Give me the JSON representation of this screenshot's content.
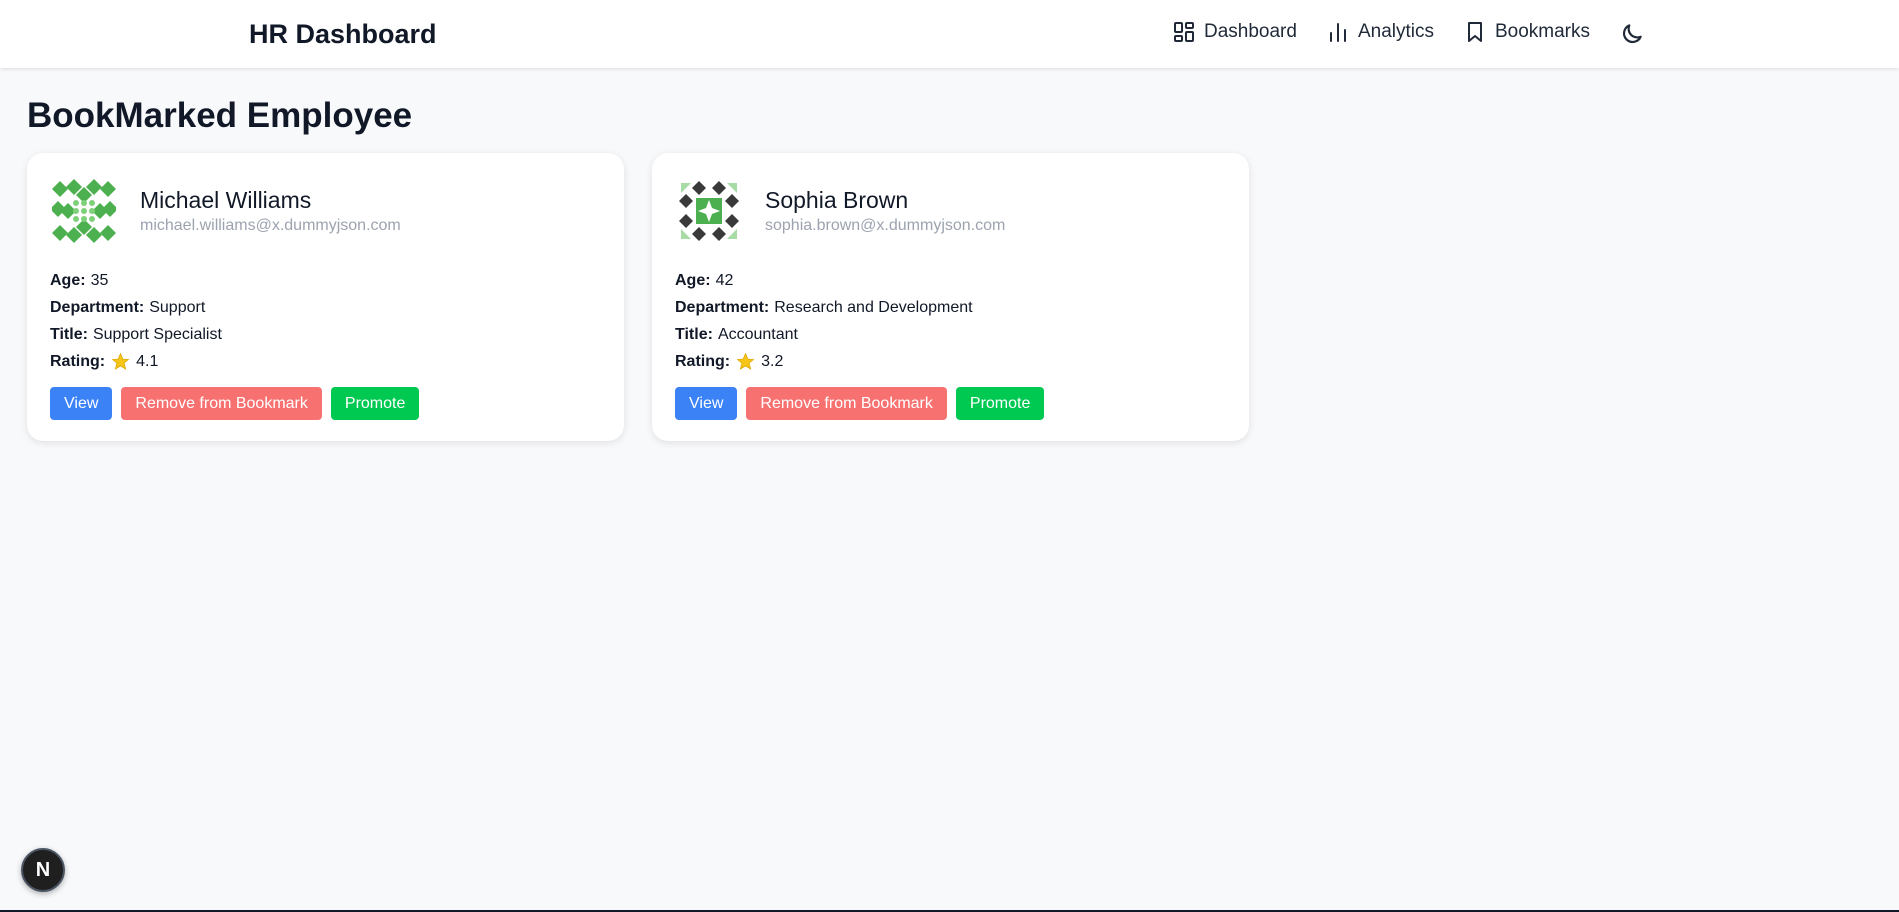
{
  "header": {
    "brand": "HR Dashboard",
    "nav": [
      {
        "label": "Dashboard",
        "icon": "dashboard-grid-icon"
      },
      {
        "label": "Analytics",
        "icon": "bar-chart-icon"
      },
      {
        "label": "Bookmarks",
        "icon": "bookmark-icon"
      }
    ],
    "theme_icon": "moon-icon"
  },
  "page": {
    "title": "BookMarked Employee"
  },
  "labels": {
    "age": "Age:",
    "department": "Department:",
    "title": "Title:",
    "rating": "Rating:",
    "view": "View",
    "remove": "Remove from Bookmark",
    "promote": "Promote"
  },
  "employees": [
    {
      "name": "Michael Williams",
      "email": "michael.williams@x.dummyjson.com",
      "age": "35",
      "department": "Support",
      "title": "Support Specialist",
      "rating": "4.1",
      "avatar_color": "#4caf50"
    },
    {
      "name": "Sophia Brown",
      "email": "sophia.brown@x.dummyjson.com",
      "age": "42",
      "department": "Research and Development",
      "title": "Accountant",
      "rating": "3.2",
      "avatar_color": "#3a3a3a"
    }
  ],
  "colors": {
    "view": "#3b82f6",
    "remove": "#f87171",
    "promote": "#00c951",
    "star": "#f5c518"
  },
  "dev_badge": {
    "letter": "N",
    "icon": "nextjs-logo-icon"
  }
}
